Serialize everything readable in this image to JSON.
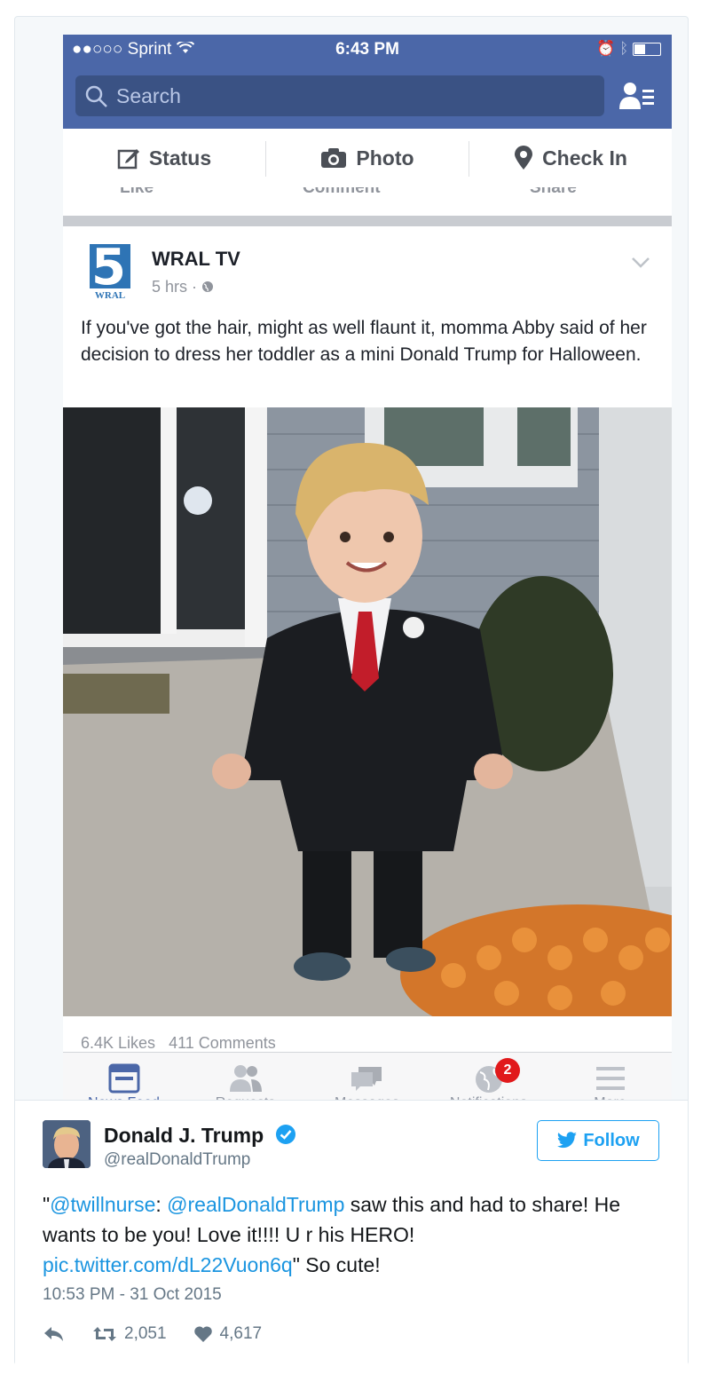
{
  "status_bar": {
    "signal": "●●○○○",
    "carrier": "Sprint",
    "time": "6:43 PM"
  },
  "search": {
    "placeholder": "Search"
  },
  "composer": {
    "status_label": "Status",
    "photo_label": "Photo",
    "checkin_label": "Check In"
  },
  "previous_post": {
    "like": "Like",
    "comment": "Comment",
    "share": "Share"
  },
  "post": {
    "logo_number": "5",
    "logo_text": "WRAL",
    "author": "WRAL TV",
    "time": "5 hrs ·",
    "text": "If you've got the hair, might as well flaunt it, momma Abby said of her decision to dress her toddler as a mini Donald Trump for Halloween.",
    "likes": "6.4K Likes",
    "comments": "411 Comments"
  },
  "tabbar": {
    "news_feed": "News Feed",
    "requests": "Requests",
    "messages": "Messages",
    "notifications": "Notifications",
    "notifications_badge": "2",
    "more": "More"
  },
  "tweet": {
    "name": "Donald J. Trump",
    "handle": "@realDonaldTrump",
    "follow_label": "Follow",
    "text_quote_open": "\"",
    "mention1": "@twillnurse",
    "colon": ":",
    "mention2": "@realDonaldTrump",
    "body1": " saw this and had to share! He wants to be you! Love it!!!! U r his HERO! ",
    "link": "pic.twitter.com/dL22Vuon6q",
    "body2": "\" So cute!",
    "date": "10:53 PM - 31 Oct 2015",
    "retweets": "2,051",
    "likes": "4,617"
  },
  "colors": {
    "facebook_blue": "#4b67a8",
    "twitter_blue": "#1da1f2",
    "link_blue": "#1b95e0",
    "badge_red": "#e1191b"
  }
}
